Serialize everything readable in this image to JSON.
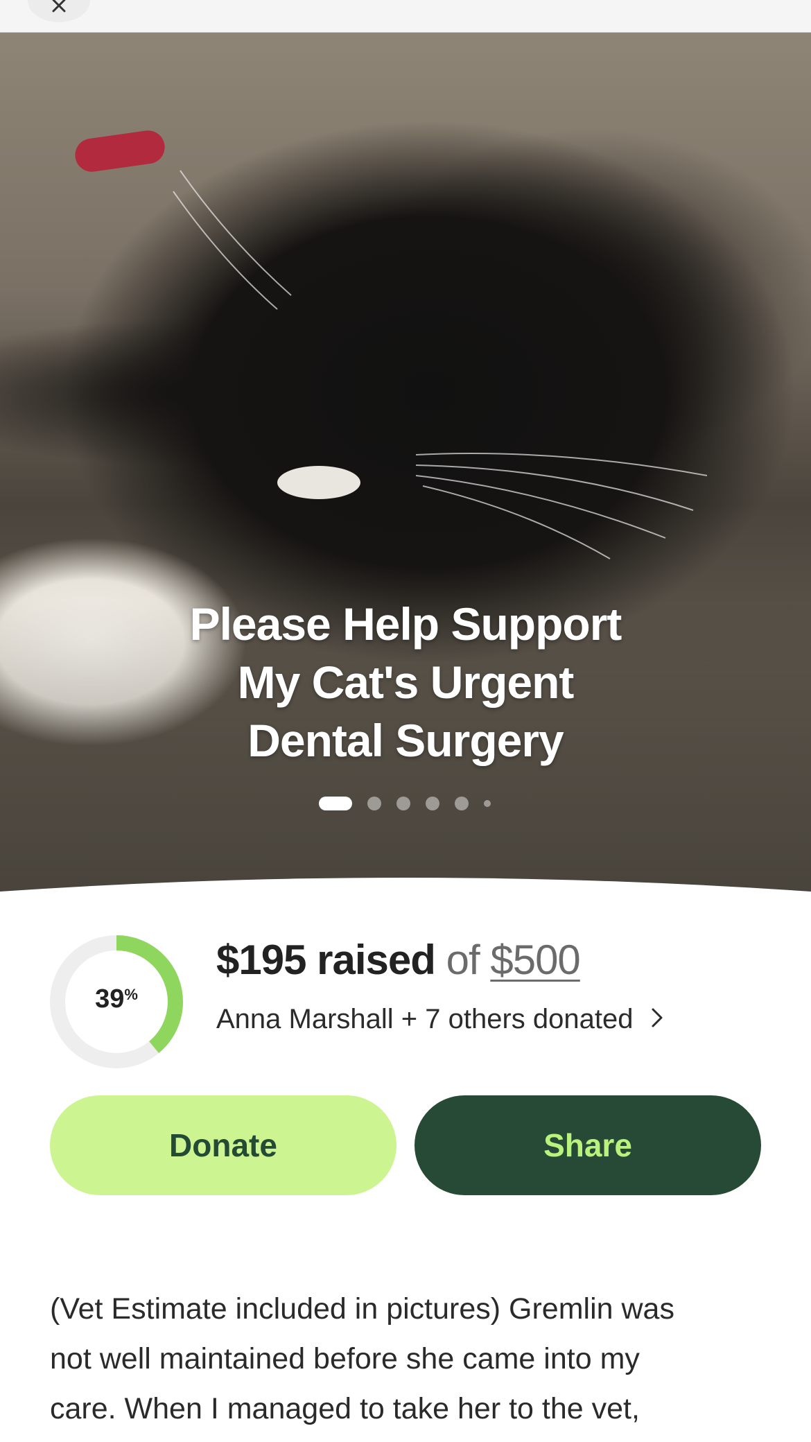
{
  "hero": {
    "title_line1": "Please Help Support",
    "title_line2": "My Cat's Urgent",
    "title_line3": "Dental Surgery",
    "image_alt": "Black and white cat sleeping on a couch",
    "carousel": {
      "count": 6,
      "active_index": 0
    }
  },
  "progress": {
    "percent": 39,
    "percent_label": "39",
    "percent_symbol": "%"
  },
  "raised": {
    "amount": "$195",
    "raised_word": "raised",
    "of_word": "of",
    "goal": "$500"
  },
  "donors_text": "Anna Marshall + 7 others donated",
  "actions": {
    "donate_label": "Donate",
    "share_label": "Share"
  },
  "story": {
    "line1": "(Vet Estimate included in pictures) Gremlin was",
    "line2": "not well maintained before she came into my",
    "line3": "care. When I managed to take her to the vet,"
  },
  "colors": {
    "donate_bg": "#ccf591",
    "share_bg": "#264a35",
    "progress_fill": "#8fd65e",
    "progress_track": "#eeeeee"
  },
  "icons": {
    "close": "close-icon",
    "chevron": "chevron-right-icon"
  }
}
